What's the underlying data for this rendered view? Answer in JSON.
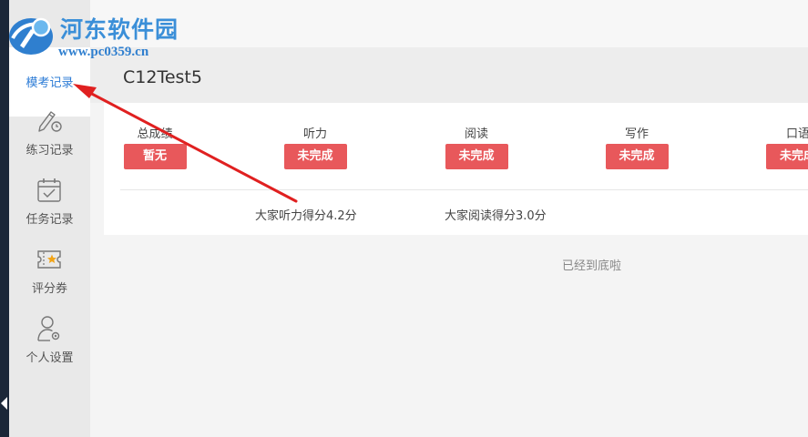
{
  "watermark": {
    "title": "河东软件园",
    "url": "www.pc0359.cn"
  },
  "sidebar": {
    "items": [
      {
        "label": "模考记录",
        "icon": "exam-record-icon",
        "active": true
      },
      {
        "label": "练习记录",
        "icon": "pencil-clock-icon",
        "active": false
      },
      {
        "label": "任务记录",
        "icon": "calendar-check-icon",
        "active": false
      },
      {
        "label": "评分券",
        "icon": "star-ticket-icon",
        "active": false
      },
      {
        "label": "个人设置",
        "icon": "user-settings-icon",
        "active": false
      }
    ]
  },
  "header": {
    "title": "C12Test5"
  },
  "scores": {
    "columns": [
      {
        "title": "总成绩",
        "status": "暂无"
      },
      {
        "title": "听力",
        "status": "未完成"
      },
      {
        "title": "阅读",
        "status": "未完成"
      },
      {
        "title": "写作",
        "status": "未完成"
      },
      {
        "title": "口语",
        "status": "未完成"
      }
    ],
    "averages": {
      "listening": "大家听力得分4.2分",
      "reading": "大家阅读得分3.0分"
    }
  },
  "footer_note": "已经到底啦",
  "colors": {
    "badge": "#e8585b",
    "accent": "#2d7cd6",
    "sidebar_edge": "#1b2738",
    "annotation_arrow": "#e02020"
  }
}
